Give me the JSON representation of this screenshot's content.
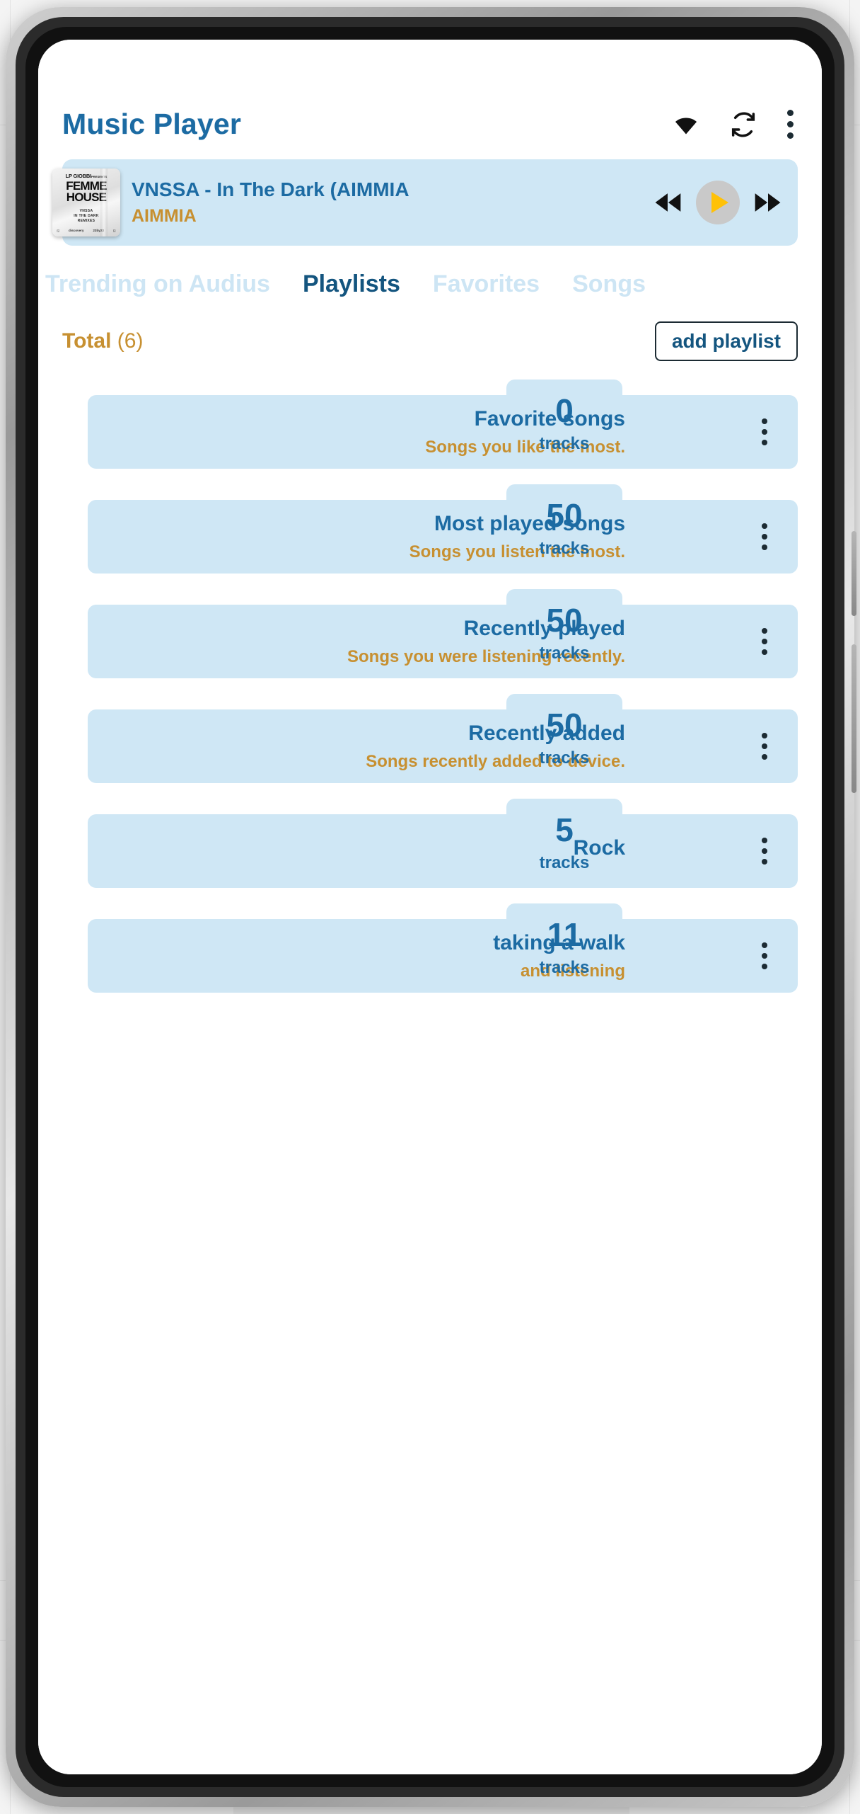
{
  "app": {
    "title": "Music Player",
    "icons": [
      {
        "name": "wifi-icon",
        "label": "wifi"
      },
      {
        "name": "sync-icon",
        "label": "refresh"
      },
      {
        "name": "overflow-menu-icon",
        "label": "more options"
      }
    ]
  },
  "player": {
    "track_title": "VNSSA - In The Dark (AIMMIA",
    "artist": "AIMMIA",
    "album_art": {
      "line1": "LP GIOBBI",
      "line1_small": "PRESENTS",
      "line2": "FEMME",
      "line3": "HOUSE",
      "sub1": "VNSSA",
      "sub2": "IN THE DARK",
      "sub3": "REMIXES",
      "foot_left": "discovery",
      "foot_right": "23by23"
    },
    "controls": {
      "previous": "previous-track",
      "play": "play",
      "next": "next-track"
    }
  },
  "tabs": [
    {
      "label": "Trending on Audius",
      "active": false
    },
    {
      "label": "Playlists",
      "active": true
    },
    {
      "label": "Favorites",
      "active": false
    },
    {
      "label": "Songs",
      "active": false
    }
  ],
  "toolbar": {
    "total_label": "Total",
    "total_count": "(6)",
    "add_playlist_label": "add playlist"
  },
  "playlists": [
    {
      "title": "Favorite songs",
      "desc": "Songs you like the most.",
      "count": "0",
      "unit": "tracks"
    },
    {
      "title": "Most played songs",
      "desc": "Songs you listen the most.",
      "count": "50",
      "unit": "tracks"
    },
    {
      "title": "Recently played",
      "desc": "Songs you were listening recently.",
      "count": "50",
      "unit": "tracks"
    },
    {
      "title": "Recently added",
      "desc": "Songs recently added to device.",
      "count": "50",
      "unit": "tracks"
    },
    {
      "title": "Rock",
      "desc": "",
      "count": "5",
      "unit": "tracks"
    },
    {
      "title": "taking a walk",
      "desc": "and listening",
      "count": "11",
      "unit": "tracks"
    }
  ],
  "colors": {
    "accent_blue": "#1c6ba3",
    "accent_blue_dark": "#14557f",
    "accent_gold": "#c79031",
    "card_bg": "#cfe7f5",
    "tab_inactive": "#cde5f4",
    "play_button_bg": "#c9c9c9",
    "play_icon": "#ffc107"
  }
}
